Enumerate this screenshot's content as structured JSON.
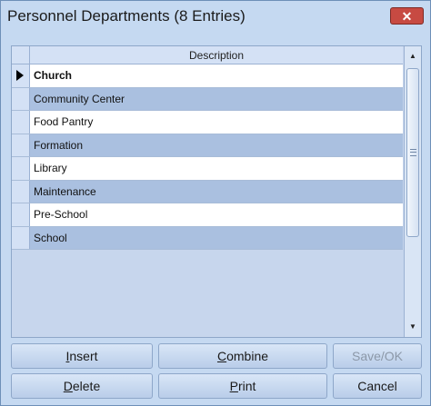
{
  "window": {
    "title": "Personnel Departments (8 Entries)"
  },
  "grid": {
    "header": {
      "description": "Description"
    },
    "rows": [
      {
        "text": "Church",
        "selected": true
      },
      {
        "text": "Community Center"
      },
      {
        "text": "Food Pantry"
      },
      {
        "text": "Formation"
      },
      {
        "text": "Library"
      },
      {
        "text": "Maintenance"
      },
      {
        "text": "Pre-School"
      },
      {
        "text": "School"
      }
    ]
  },
  "buttons": {
    "insert": {
      "accel": "I",
      "rest": "nsert"
    },
    "combine": {
      "accel": "C",
      "rest": "ombine"
    },
    "save_ok": "Save/OK",
    "delete": {
      "accel": "D",
      "rest": "elete"
    },
    "print": {
      "accel": "P",
      "rest": "rint"
    },
    "cancel": "Cancel"
  },
  "icons": {
    "close": "close-icon",
    "scroll_up": "scroll-up-icon",
    "scroll_down": "scroll-down-icon",
    "row_pointer": "row-pointer-icon"
  },
  "colors": {
    "row_alt": "#aac0e0",
    "window_bg": "#c5d9f1",
    "close_red": "#c74a42"
  }
}
